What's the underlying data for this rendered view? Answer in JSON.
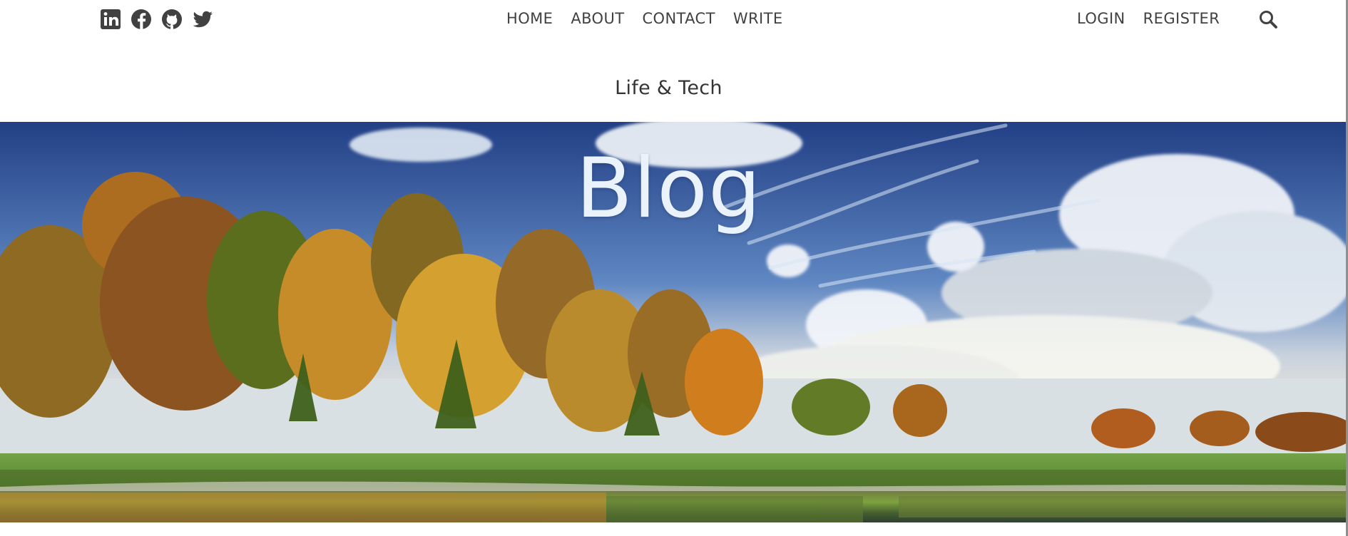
{
  "header": {
    "social_icons": [
      "linkedin-icon",
      "facebook-icon",
      "github-icon",
      "twitter-icon"
    ],
    "nav_center": [
      "HOME",
      "ABOUT",
      "CONTACT",
      "WRITE"
    ],
    "nav_right": [
      "LOGIN",
      "REGISTER"
    ],
    "search_icon": "search-icon"
  },
  "site": {
    "title": "Life & Tech"
  },
  "hero": {
    "title": "Blog"
  },
  "colors": {
    "text": "#414141",
    "sky": "#294a91",
    "hero_title": "#eaf2fb"
  }
}
